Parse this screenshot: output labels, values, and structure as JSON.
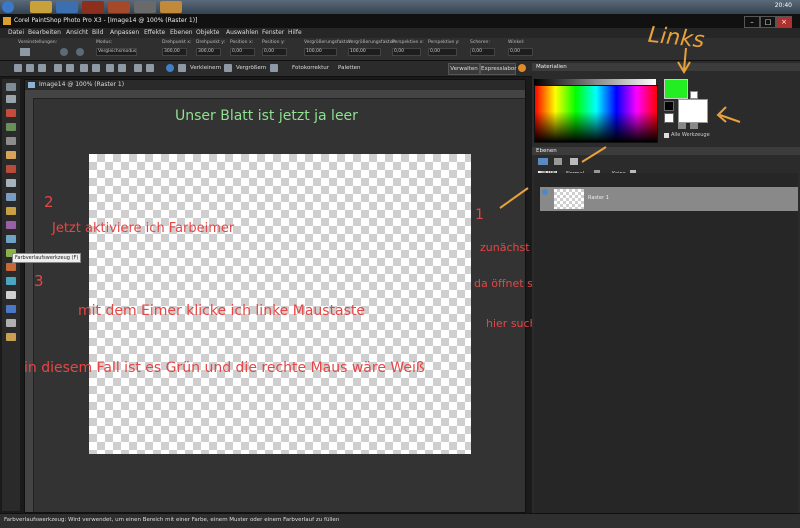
{
  "taskbar": {
    "clock": "20:40"
  },
  "window": {
    "title": "Corel PaintShop Photo Pro X3 - [Image14 @ 100% (Raster 1)]"
  },
  "menu": [
    "Datei",
    "Bearbeiten",
    "Ansicht",
    "Bild",
    "Anpassen",
    "Effekte",
    "Ebenen",
    "Objekte",
    "Auswahlen",
    "Fenster",
    "Hilfe"
  ],
  "tool_options": {
    "voreinstellungen": "Voreinstellungen:",
    "modus_label": "Modus:",
    "modus_value": "Vergleichsmodus",
    "fields": [
      "Drehpunkt x:",
      "Drehpunkt y:",
      "Position x:",
      "Position y:",
      "Vergrößerungsfaktor:",
      "Vergrößerungsfaktor:",
      "Perspektive x:",
      "Perspektive y:",
      "Scheren:",
      "Winkel:"
    ],
    "values": [
      "300,00",
      "300,00",
      "0,00",
      "0,00",
      "100,00",
      "100,00",
      "0,00",
      "0,00",
      "0,00",
      "0,00"
    ]
  },
  "std_bar": {
    "verkleinern": "Verkleinern",
    "vergroessern": "Vergrößern",
    "fotokorrektur": "Fotokorrektur",
    "paletten": "Paletten",
    "verwalten": "Verwalten",
    "expresslabor": "Expresslabor"
  },
  "document": {
    "tab_title": "Image14 @ 100% (Raster 1)"
  },
  "tooltip": "Farbverlaufswerkzeug (F)",
  "annotations": {
    "blatt": "Unser  Blatt  ist jetzt  ja  leer",
    "num2": "2",
    "farbeimer": "Jetzt  aktiviere ich  Farbeimer",
    "num3": "3",
    "eimer": "mit  dem  Eimer   klicke ich  linke Maustaste",
    "gruen": "in diesem Fall ist  es  Grün und die rechte  Maus  wäre Weiß",
    "num1": "1",
    "viereck": "zunächst klicke ich auf das  grüne vier Eck",
    "farbkugel": "da öffnet sich eine  Farbkugel  sie Bild Unten",
    "farbe": "hier suche ich  mir eine Farbe aus",
    "links": "Links"
  },
  "materials": {
    "title": "Materialien",
    "alle_werkzeuge": "Alle Werkzeuge",
    "fg_color": "#22ee22",
    "bg_color": "#ffffff"
  },
  "layers": {
    "title": "Ebenen",
    "opacity": "100",
    "blend": "Normal",
    "keine": "Keine",
    "layer_name": "Raster 1"
  },
  "status": "Farbverlaufswerkzeug: Wird verwendet, um einen Bereich mit einer Farbe, einem Muster oder einem Farbverlauf zu füllen",
  "colors": {
    "annotation_red": "#e84545",
    "annotation_green": "#8fe08f",
    "handwriting_orange": "#e9a23b"
  }
}
